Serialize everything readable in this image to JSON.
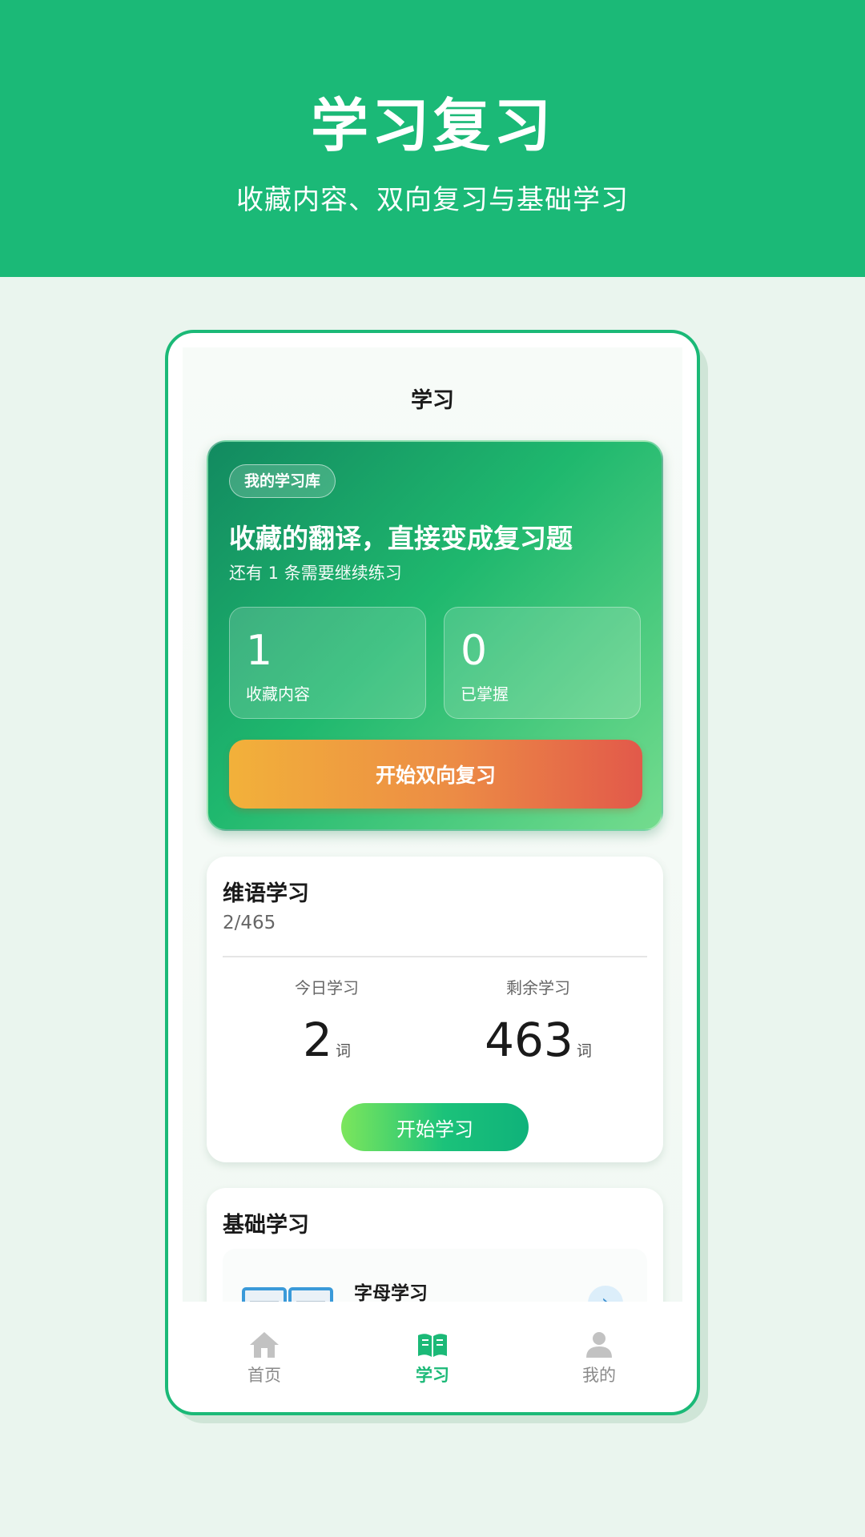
{
  "hero": {
    "title": "学习复习",
    "subtitle": "收藏内容、双向复习与基础学习"
  },
  "screen": {
    "nav_title": "学习"
  },
  "library": {
    "pill": "我的学习库",
    "headline": "收藏的翻译，直接变成复习题",
    "remaining": "还有 1 条需要继续练习",
    "stats": [
      {
        "value": "1",
        "label": "收藏内容"
      },
      {
        "value": "0",
        "label": "已掌握"
      }
    ],
    "review_button": "开始双向复习"
  },
  "uyghur_study": {
    "title": "维语学习",
    "progress": "2/465",
    "today_label": "今日学习",
    "today_value": "2",
    "remaining_label": "剩余学习",
    "remaining_value": "463",
    "unit": "词",
    "start_button": "开始学习"
  },
  "basic_study": {
    "title": "基础学习",
    "item_title": "字母学习",
    "arrow": "›"
  },
  "tabbar": {
    "items": [
      {
        "label": "首页",
        "icon": "home-icon"
      },
      {
        "label": "学习",
        "icon": "book-icon"
      },
      {
        "label": "我的",
        "icon": "user-icon"
      }
    ],
    "active_color": "#1bb977"
  },
  "colors": {
    "brand": "#1bb977",
    "review_start": "#f2b13a",
    "review_end": "#e2594a"
  }
}
